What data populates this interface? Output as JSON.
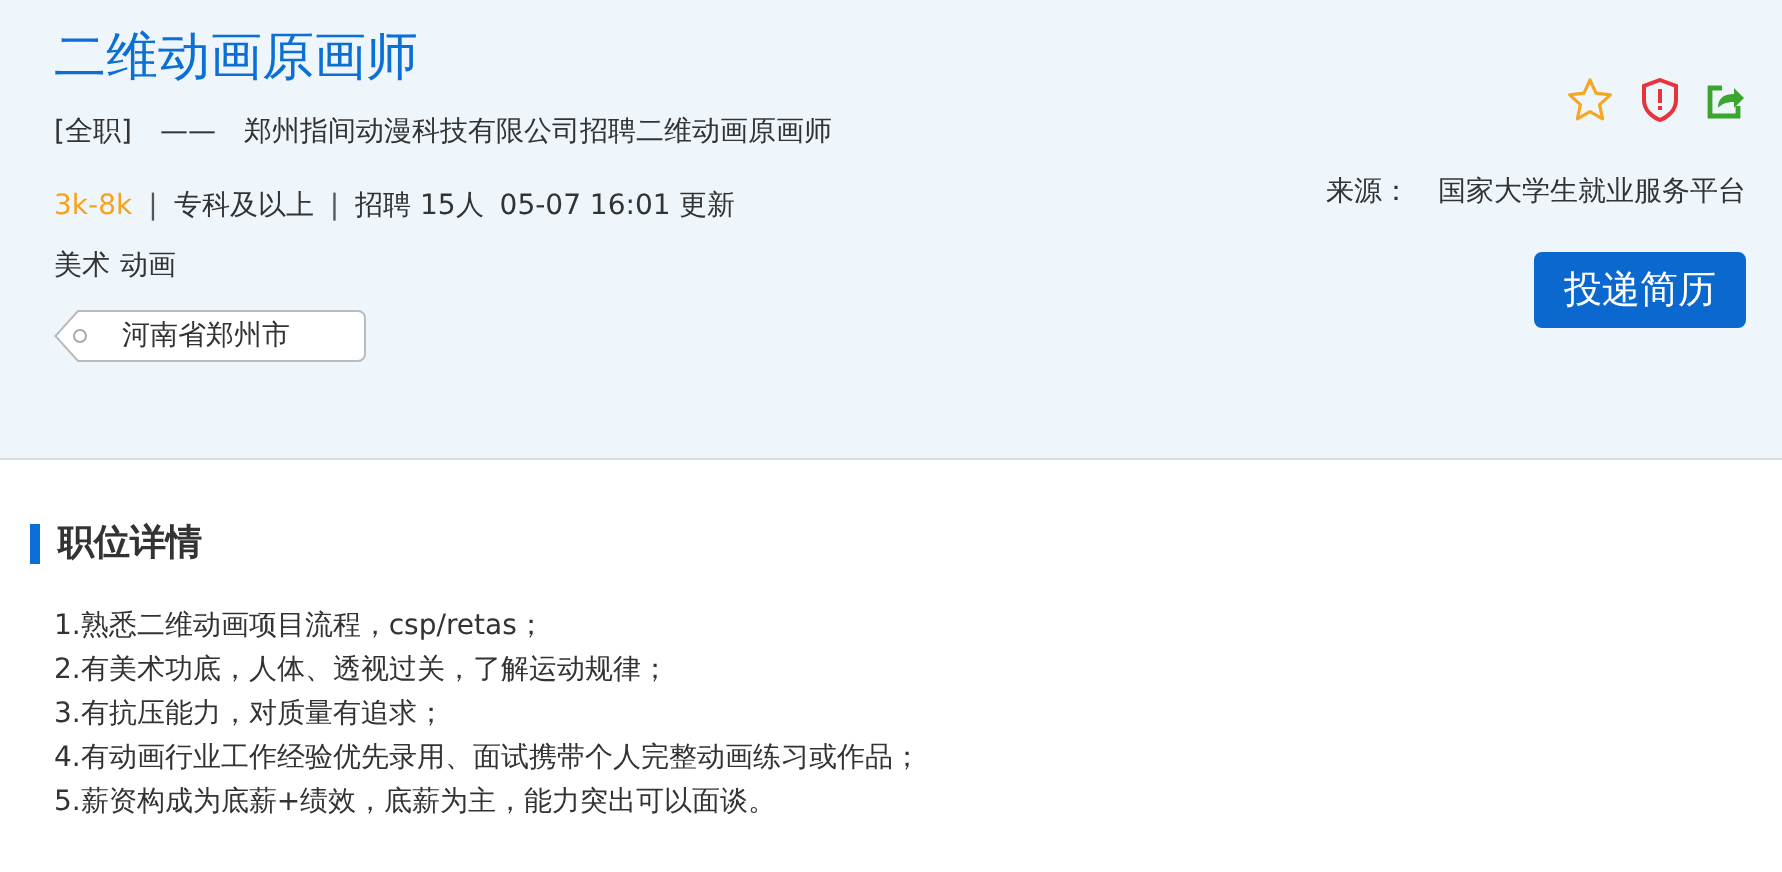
{
  "job": {
    "title": "二维动画原画师",
    "employment_type": "[全职]",
    "separator": "——",
    "headline": "郑州指间动漫科技有限公司招聘二维动画原画师",
    "salary": "3k-8k",
    "divider": "|",
    "education": "专科及以上",
    "headcount": "招聘 15人",
    "updated": "05-07 16:01 更新",
    "tags": [
      "美术",
      "动画"
    ],
    "location": "河南省郑州市",
    "source_label": "来源：",
    "source": "国家大学生就业服务平台",
    "apply_button": "投递简历"
  },
  "details": {
    "heading": "职位详情",
    "lines": [
      "1.熟悉二维动画项目流程，csp/retas；",
      "2.有美术功底，人体、透视过关，了解运动规律；",
      "3.有抗压能力，对质量有追求；",
      "4.有动画行业工作经验优先录用、面试携带个人完整动画练习或作品；",
      "5.薪资构成为底薪+绩效，底薪为主，能力突出可以面谈。"
    ]
  }
}
